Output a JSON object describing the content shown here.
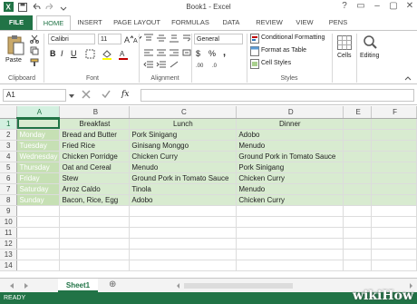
{
  "window": {
    "title": "Book1 - Excel",
    "controls": [
      "?",
      "▭",
      "–",
      "▢",
      "✕"
    ]
  },
  "tabs": [
    "FILE",
    "HOME",
    "INSERT",
    "PAGE LAYOUT",
    "FORMULAS",
    "DATA",
    "REVIEW",
    "VIEW",
    "PENS"
  ],
  "ribbon": {
    "clipboard": {
      "paste": "Paste",
      "label": "Clipboard"
    },
    "font": {
      "name": "Calibri",
      "size": "11",
      "bold": "B",
      "italic": "I",
      "underline": "U",
      "label": "Font"
    },
    "alignment": {
      "label": "Alignment"
    },
    "number": {
      "format": "General",
      "label": "Number",
      "currency": "$",
      "percent": "%",
      "comma": ","
    },
    "styles": {
      "conditional": "Conditional Formatting",
      "table": "Format as Table",
      "cell": "Cell Styles",
      "label": "Styles"
    },
    "cells": {
      "label": "Cells"
    },
    "editing": {
      "label": "Editing"
    }
  },
  "formula_bar": {
    "name_box": "A1",
    "fx": "fx",
    "content": ""
  },
  "columns": [
    "A",
    "B",
    "C",
    "D",
    "E",
    "F"
  ],
  "rows": [
    {
      "num": "1",
      "a": "",
      "b": "Breakfast",
      "c": "Lunch",
      "d": "Dinner"
    },
    {
      "num": "2",
      "a": "Monday",
      "b": "Bread and Butter",
      "c": "Pork Sinigang",
      "d": "Adobo"
    },
    {
      "num": "3",
      "a": "Tuesday",
      "b": "Fried Rice",
      "c": "Ginisang Monggo",
      "d": "Menudo"
    },
    {
      "num": "4",
      "a": "Wednesday",
      "b": "Chicken Porridge",
      "c": "Chicken Curry",
      "d": "Ground Pork in Tomato Sauce"
    },
    {
      "num": "5",
      "a": "Thursday",
      "b": "Oat and Cereal",
      "c": "Menudo",
      "d": "Pork Sinigang"
    },
    {
      "num": "6",
      "a": "Friday",
      "b": "Stew",
      "c": "Ground Pork in Tomato Sauce",
      "d": "Chicken Curry"
    },
    {
      "num": "7",
      "a": "Saturday",
      "b": "Arroz Caldo",
      "c": "Tinola",
      "d": "Menudo"
    },
    {
      "num": "8",
      "a": "Sunday",
      "b": "Bacon, Rice, Egg",
      "c": "Adobo",
      "d": "Chicken Curry"
    },
    {
      "num": "9"
    },
    {
      "num": "10"
    },
    {
      "num": "11"
    },
    {
      "num": "12"
    },
    {
      "num": "13"
    },
    {
      "num": "14"
    }
  ],
  "sheet_tab": "Sheet1",
  "add_sheet": "⊕",
  "status": "READY",
  "watermark": "wikiHow",
  "colors": {
    "accent": "#217346",
    "fill": "#d8ebd0"
  }
}
